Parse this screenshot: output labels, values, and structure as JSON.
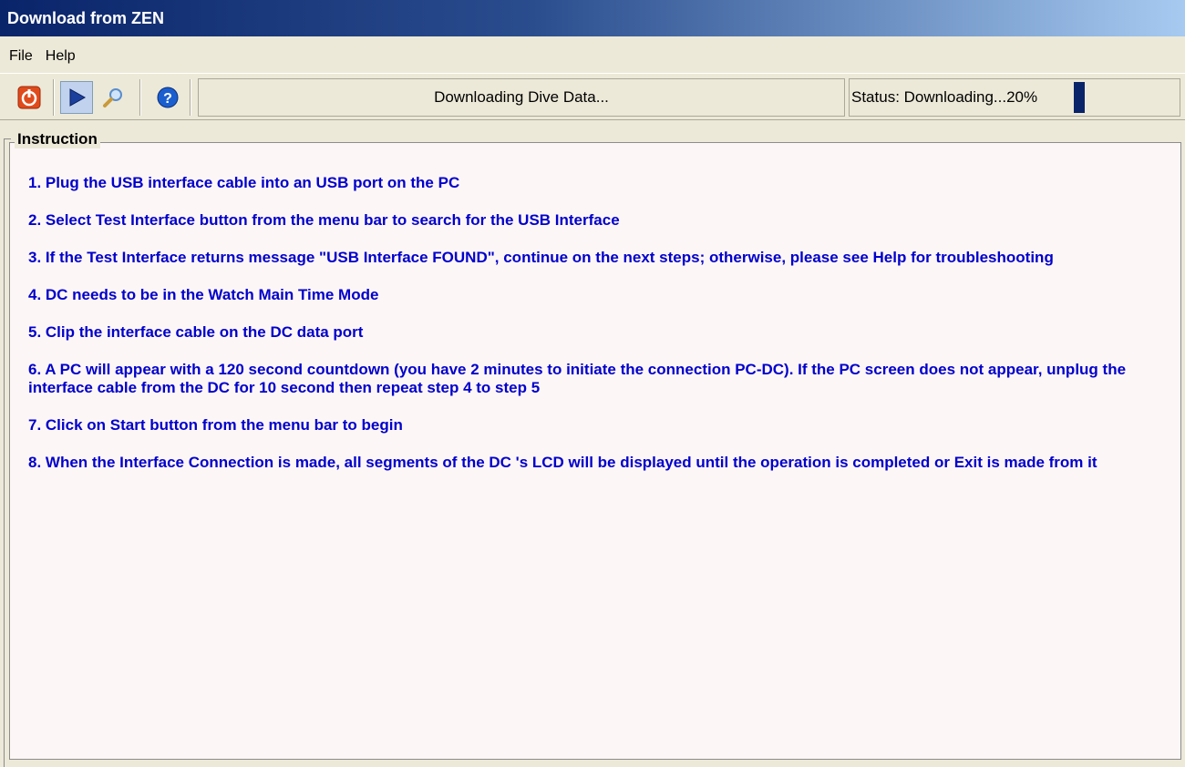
{
  "window": {
    "title": "Download from ZEN"
  },
  "menu": {
    "file": "File",
    "help": "Help"
  },
  "toolbar": {
    "buttons": [
      {
        "icon": "power-icon",
        "color": "#e04b1c"
      },
      {
        "icon": "start-play-icon",
        "color": "#1b3f9c"
      },
      {
        "icon": "magnifier-icon",
        "color": "#5a8dcc"
      },
      {
        "icon": "help-icon",
        "color": "#1b5fcf"
      }
    ],
    "message": "Downloading Dive Data...",
    "status": "Status: Downloading...20%",
    "progress_fraction": 0.2
  },
  "instruction": {
    "legend": "Instruction",
    "steps": [
      "1. Plug the USB interface cable into an USB port on the PC",
      "2. Select Test Interface button from the menu bar to search for the USB Interface",
      "3. If the Test Interface returns message \"USB Interface FOUND\", continue on the next steps; otherwise, please see Help for troubleshooting",
      "4. DC needs to be in the Watch Main Time Mode",
      "5. Clip the interface cable on the DC data port",
      "6. A PC will appear with a 120 second countdown (you have 2 minutes to initiate the connection PC-DC). If the  PC screen does not appear, unplug the interface cable from the DC for 10 second then repeat step 4 to step 5",
      "7. Click on Start button from the menu bar to begin",
      "8. When the Interface Connection is made, all segments of the DC 's LCD will be displayed until the operation is completed or Exit is made from it"
    ]
  },
  "colors": {
    "text_blue": "#0000cc",
    "title_dark": "#0a246a",
    "progress": "#0a246a"
  }
}
